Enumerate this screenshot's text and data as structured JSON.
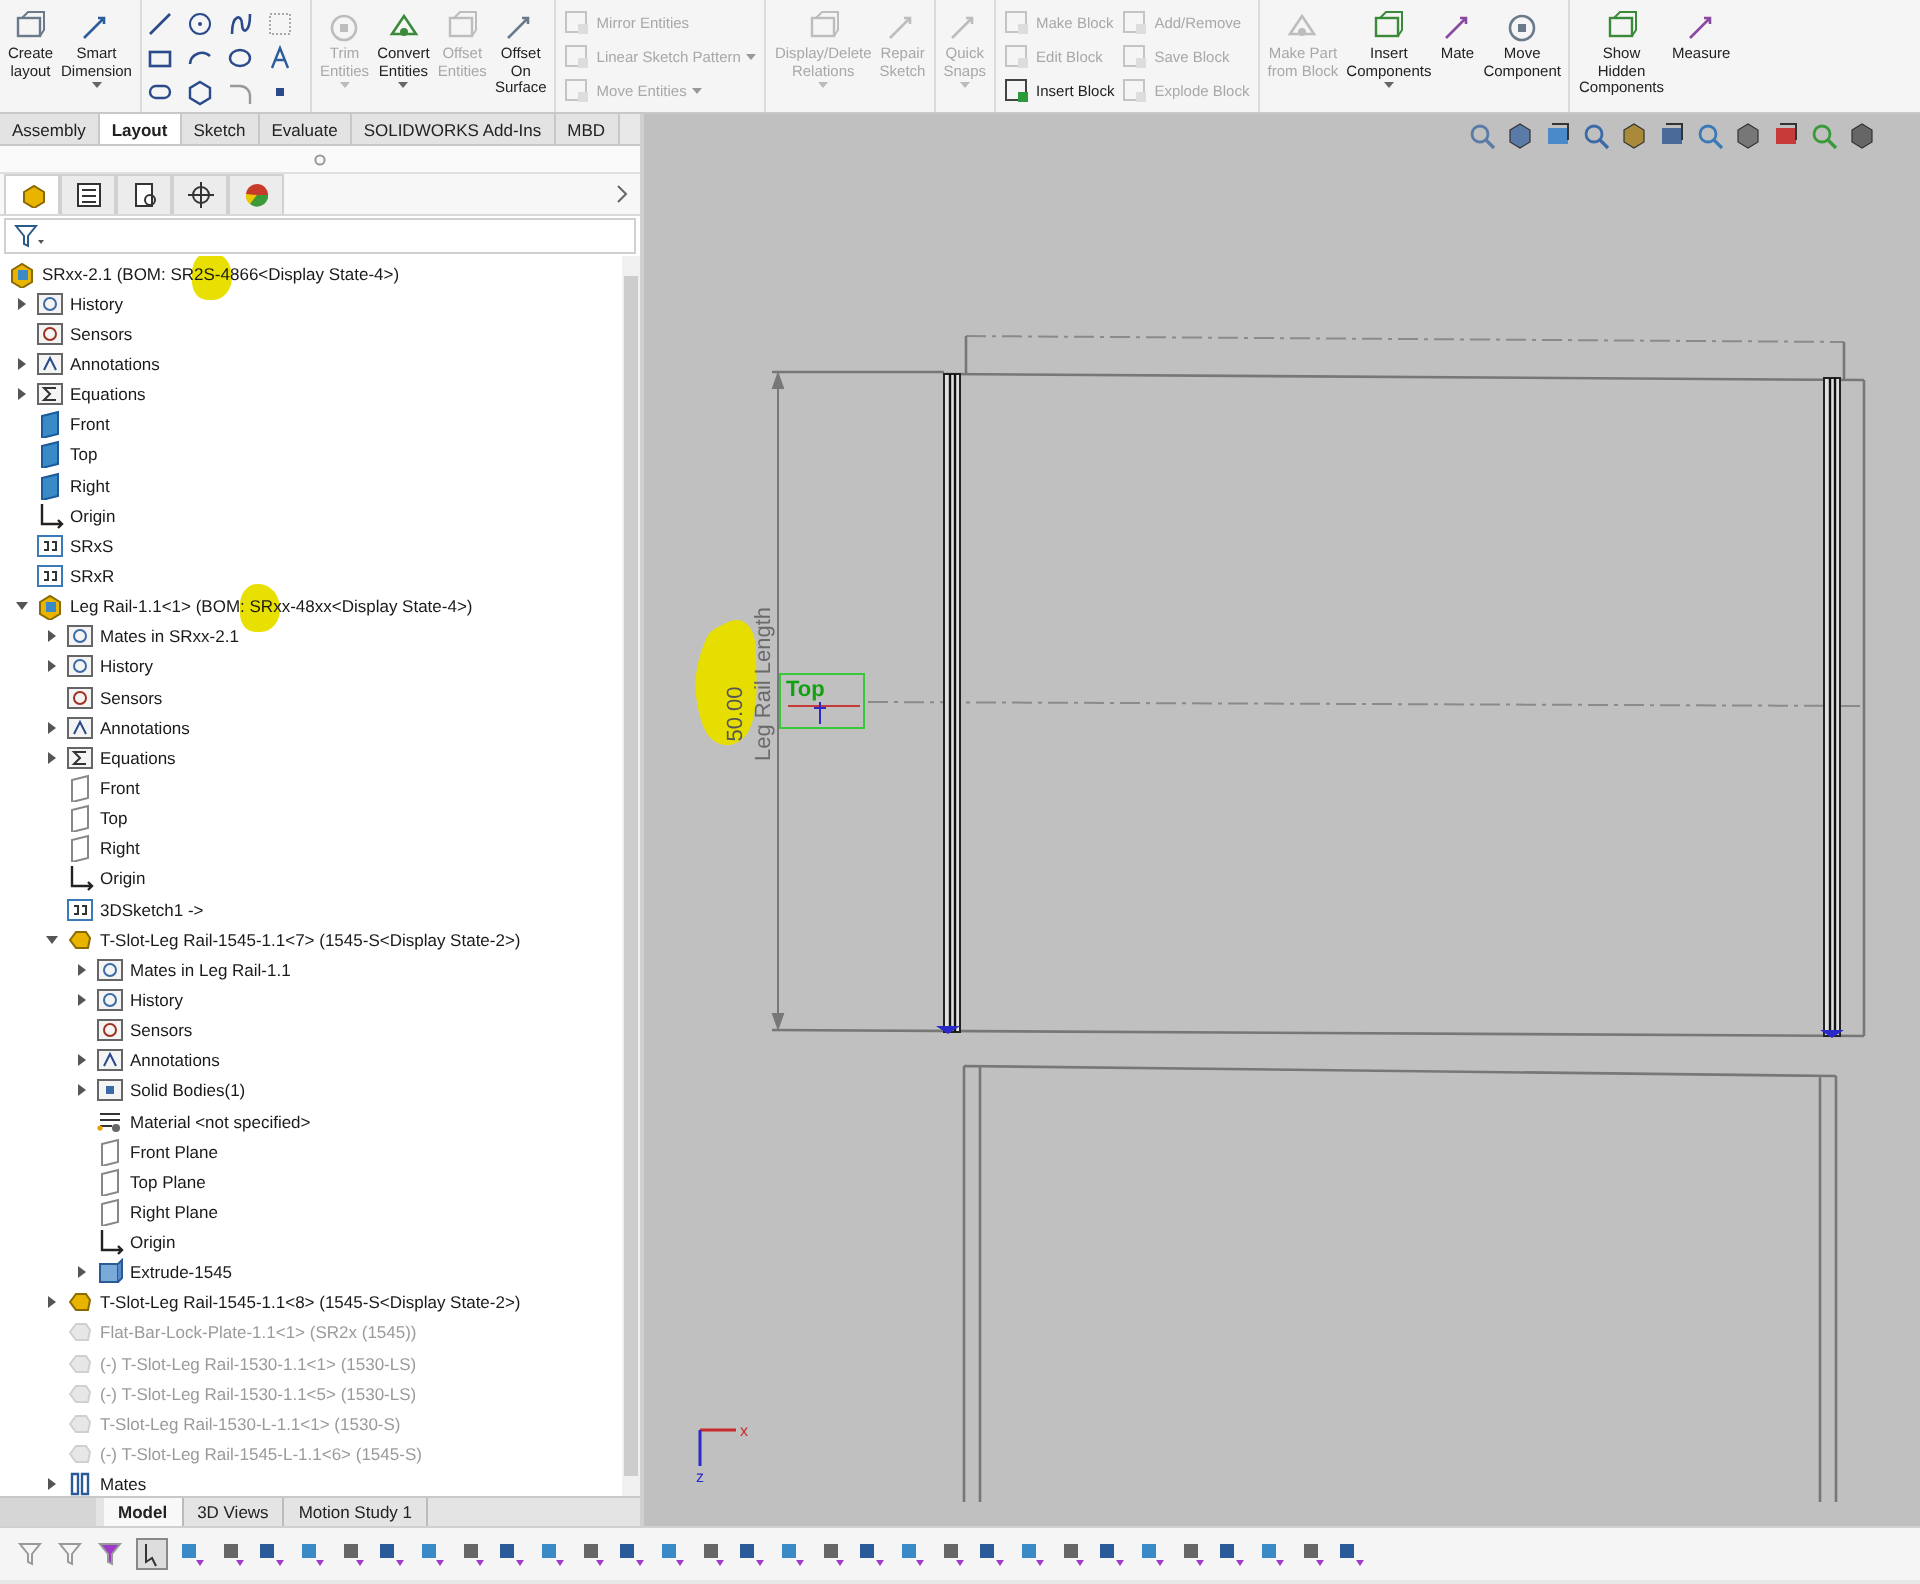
{
  "ribbon": {
    "groups": [
      {
        "kind": "large",
        "buttons": [
          {
            "label": "Create\nlayout",
            "disabled": false,
            "menu": false
          },
          {
            "label": "Smart\nDimension",
            "disabled": false,
            "menu": true
          }
        ]
      },
      {
        "kind": "sketch"
      },
      {
        "kind": "large",
        "buttons": [
          {
            "label": "Trim\nEntities",
            "disabled": true,
            "menu": true
          },
          {
            "label": "Convert\nEntities",
            "disabled": false,
            "menu": true
          },
          {
            "label": "Offset\nEntities",
            "disabled": true,
            "menu": false
          },
          {
            "label": "Offset\nOn\nSurface",
            "disabled": false,
            "menu": false
          }
        ]
      },
      {
        "kind": "list",
        "columns": [
          [
            {
              "label": "Mirror Entities",
              "disabled": true,
              "menu": false
            },
            {
              "label": "Linear Sketch Pattern",
              "disabled": true,
              "menu": true
            },
            {
              "label": "Move Entities",
              "disabled": true,
              "menu": true
            }
          ]
        ]
      },
      {
        "kind": "large",
        "buttons": [
          {
            "label": "Display/Delete\nRelations",
            "disabled": true,
            "menu": true
          },
          {
            "label": "Repair\nSketch",
            "disabled": true,
            "menu": false
          }
        ]
      },
      {
        "kind": "large",
        "buttons": [
          {
            "label": "Quick\nSnaps",
            "disabled": true,
            "menu": true
          }
        ]
      },
      {
        "kind": "list",
        "columns": [
          [
            {
              "label": "Make Block",
              "disabled": true,
              "menu": false
            },
            {
              "label": "Edit Block",
              "disabled": true,
              "menu": false
            },
            {
              "label": "Insert Block",
              "disabled": false,
              "menu": false
            }
          ],
          [
            {
              "label": "Add/Remove",
              "disabled": true,
              "menu": false
            },
            {
              "label": "Save Block",
              "disabled": true,
              "menu": false
            },
            {
              "label": "Explode Block",
              "disabled": true,
              "menu": false
            }
          ]
        ]
      },
      {
        "kind": "large",
        "buttons": [
          {
            "label": "Make Part\nfrom Block",
            "disabled": true,
            "menu": false
          },
          {
            "label": "Insert\nComponents",
            "disabled": false,
            "menu": true
          },
          {
            "label": "Mate",
            "disabled": false,
            "menu": false
          },
          {
            "label": "Move\nComponent",
            "disabled": false,
            "menu": false
          }
        ]
      },
      {
        "kind": "large",
        "buttons": [
          {
            "label": "Show\nHidden\nComponents",
            "disabled": false,
            "menu": false
          },
          {
            "label": "Measure",
            "disabled": false,
            "menu": false
          }
        ]
      }
    ]
  },
  "command_tabs": [
    {
      "label": "Assembly",
      "selected": false
    },
    {
      "label": "Layout",
      "selected": true
    },
    {
      "label": "Sketch",
      "selected": false
    },
    {
      "label": "Evaluate",
      "selected": false
    },
    {
      "label": "SOLIDWORKS Add-Ins",
      "selected": false
    },
    {
      "label": "MBD",
      "selected": false
    }
  ],
  "panel_tabs": [
    {
      "selected": true
    },
    {
      "selected": false
    },
    {
      "selected": false
    },
    {
      "selected": false
    },
    {
      "selected": false
    }
  ],
  "tree": [
    {
      "label": "SRxx-2.1  (BOM: SR2S-4866<Display State-4>)",
      "kind": "assembly",
      "highlighted": true,
      "children": [
        {
          "label": "History",
          "kind": "history",
          "expanded": false,
          "highlighted": false
        },
        {
          "label": "Sensors",
          "kind": "sensors",
          "highlighted": false
        },
        {
          "label": "Annotations",
          "kind": "annotations",
          "expanded": false,
          "highlighted": false
        },
        {
          "label": "Equations",
          "kind": "equations",
          "expanded": false,
          "highlighted": false
        },
        {
          "label": "Front",
          "kind": "plane",
          "highlighted": false
        },
        {
          "label": "Top",
          "kind": "plane",
          "highlighted": false
        },
        {
          "label": "Right",
          "kind": "plane",
          "highlighted": false
        },
        {
          "label": "Origin",
          "kind": "origin",
          "highlighted": false
        },
        {
          "label": "SRxS",
          "kind": "sketch",
          "highlighted": false
        },
        {
          "label": "SRxR",
          "kind": "sketch",
          "highlighted": false
        },
        {
          "label": "Leg Rail-1.1<1> (BOM: SRxx-48xx<Display State-4>)",
          "kind": "assembly",
          "expanded": true,
          "highlighted": true,
          "children": [
            {
              "label": "Mates in SRxx-2.1",
              "kind": "matesfolder",
              "expanded": false,
              "suppressed": false
            },
            {
              "label": "History",
              "kind": "history",
              "expanded": false,
              "suppressed": false
            },
            {
              "label": "Sensors",
              "kind": "sensors",
              "suppressed": false
            },
            {
              "label": "Annotations",
              "kind": "annotations",
              "expanded": false,
              "suppressed": false
            },
            {
              "label": "Equations",
              "kind": "equations",
              "expanded": false,
              "suppressed": false
            },
            {
              "label": "Front",
              "kind": "refplane",
              "suppressed": false
            },
            {
              "label": "Top",
              "kind": "refplane",
              "suppressed": false
            },
            {
              "label": "Right",
              "kind": "refplane",
              "suppressed": false
            },
            {
              "label": "Origin",
              "kind": "origin",
              "suppressed": false
            },
            {
              "label": "3DSketch1 ->",
              "kind": "sketch",
              "suppressed": false
            },
            {
              "label": "T-Slot-Leg Rail-1545-1.1<7> (1545-S<Display State-2>)",
              "kind": "part",
              "expanded": true,
              "suppressed": false,
              "children": [
                {
                  "label": "Mates in Leg Rail-1.1",
                  "kind": "matesfolder",
                  "expanded": false
                },
                {
                  "label": "History",
                  "kind": "history",
                  "expanded": false
                },
                {
                  "label": "Sensors",
                  "kind": "sensors"
                },
                {
                  "label": "Annotations",
                  "kind": "annotations",
                  "expanded": false
                },
                {
                  "label": "Solid Bodies(1)",
                  "kind": "bodies",
                  "expanded": false
                },
                {
                  "label": "Material <not specified>",
                  "kind": "material"
                },
                {
                  "label": "Front Plane",
                  "kind": "refplane"
                },
                {
                  "label": "Top Plane",
                  "kind": "refplane"
                },
                {
                  "label": "Right Plane",
                  "kind": "refplane"
                },
                {
                  "label": "Origin",
                  "kind": "origin"
                },
                {
                  "label": "Extrude-1545",
                  "kind": "feature",
                  "expanded": false
                }
              ]
            },
            {
              "label": "T-Slot-Leg Rail-1545-1.1<8> (1545-S<Display State-2>)",
              "kind": "part",
              "expanded": false,
              "suppressed": false
            },
            {
              "label": "Flat-Bar-Lock-Plate-1.1<1> (SR2x (1545))",
              "kind": "part",
              "suppressed": true
            },
            {
              "label": "(-) T-Slot-Leg Rail-1530-1.1<1> (1530-LS)",
              "kind": "part",
              "suppressed": true
            },
            {
              "label": "(-) T-Slot-Leg Rail-1530-1.1<5> (1530-LS)",
              "kind": "part",
              "suppressed": true
            },
            {
              "label": "T-Slot-Leg Rail-1530-L-1.1<1> (1530-S)",
              "kind": "part",
              "suppressed": true
            },
            {
              "label": "(-) T-Slot-Leg Rail-1545-L-1.1<6> (1545-S)",
              "kind": "part",
              "suppressed": true
            },
            {
              "label": "Mates",
              "kind": "mates",
              "expanded": false,
              "suppressed": false
            }
          ]
        }
      ]
    }
  ],
  "canvas": {
    "dimension": {
      "value": "50.00",
      "label": "Leg Rail Length",
      "highlighted": true
    },
    "view_label": "Top",
    "triad": {
      "x_label": "x",
      "z_label": "z"
    }
  },
  "bottom_tabs": [
    {
      "label": "Model",
      "selected": true
    },
    {
      "label": "3D Views",
      "selected": false
    },
    {
      "label": "Motion Study 1",
      "selected": false
    }
  ]
}
